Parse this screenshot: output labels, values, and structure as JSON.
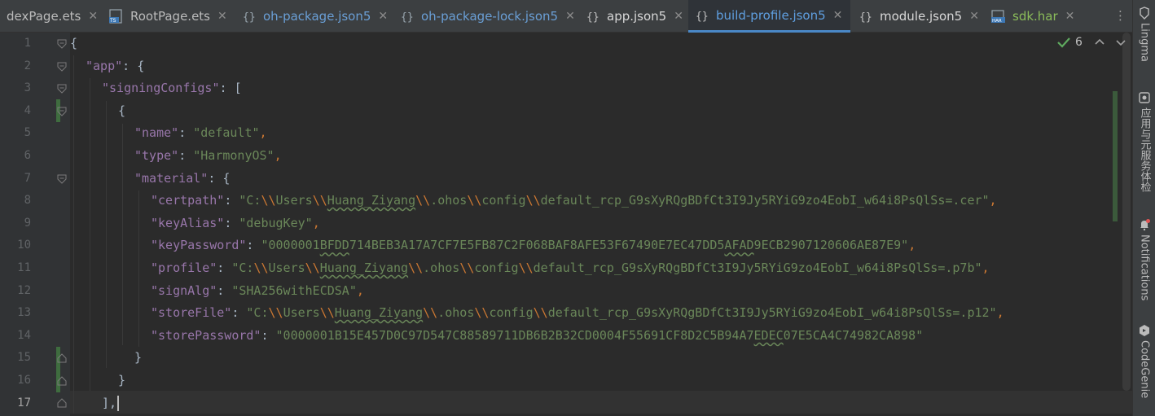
{
  "tabs": [
    {
      "label": "dexPage.ets",
      "icon": "ets-file-icon",
      "type": "ts"
    },
    {
      "label": "RootPage.ets",
      "icon": "ets-file-icon",
      "type": "ts"
    },
    {
      "label": "oh-package.json5",
      "icon": "json5-file-icon",
      "type": "json5"
    },
    {
      "label": "oh-package-lock.json5",
      "icon": "json5-file-icon",
      "type": "json5"
    },
    {
      "label": "app.json5",
      "icon": "json5-file-icon",
      "type": "plain"
    },
    {
      "label": "build-profile.json5",
      "icon": "json5-file-icon",
      "type": "active"
    },
    {
      "label": "module.json5",
      "icon": "json5-file-icon",
      "type": "plain"
    },
    {
      "label": "sdk.har",
      "icon": "har-file-icon",
      "type": "har"
    }
  ],
  "tab_close_glyph": "✕",
  "tabs_more_glyph": "⋮",
  "line_numbers": [
    "1",
    "2",
    "3",
    "4",
    "5",
    "6",
    "7",
    "8",
    "9",
    "10",
    "11",
    "12",
    "13",
    "14",
    "15",
    "16",
    "17"
  ],
  "current_line": "17",
  "inspection": {
    "count": "6"
  },
  "code": {
    "open_brace": "{",
    "app_key": "\"app\"",
    "signing_key": "\"signingConfigs\"",
    "open_bracket": "[",
    "obj_open": "{",
    "name_key": "\"name\"",
    "name_val": "\"default\"",
    "type_key": "\"type\"",
    "type_val": "\"HarmonyOS\"",
    "material_key": "\"material\"",
    "certpath_key": "\"certpath\"",
    "path_prefix": "\"C:",
    "users": "Users",
    "user": "Huang_Ziyang",
    "ohos": ".ohos",
    "config": "config",
    "cert_file": "default_rcp_G9sXyRQgBDfCt3I9Jy5RYiG9zo4EobI_w64i8PsQlSs=.cer\"",
    "keyalias_key": "\"keyAlias\"",
    "keyalias_val": "\"debugKey\"",
    "keypassword_key": "\"keyPassword\"",
    "kp_a": "\"0000001",
    "kp_b": "BFDD",
    "kp_c": "714BEB3A17A7CF7E5FB87C2F068BAF8AFE53F67490E7EC47DD5",
    "kp_d": "AFAD",
    "kp_e": "9ECB2907120606AE87E9\"",
    "profile_key": "\"profile\"",
    "profile_file": "default_rcp_G9sXyRQgBDfCt3I9Jy5RYiG9zo4EobI_w64i8PsQlSs=.p7b\"",
    "signalg_key": "\"signAlg\"",
    "signalg_val": "\"SHA256withECDSA\"",
    "storefile_key": "\"storeFile\"",
    "store_file": "default_rcp_G9sXyRQgBDfCt3I9Jy5RYiG9zo4EobI_w64i8PsQlSs=.p12\"",
    "storepassword_key": "\"storePassword\"",
    "sp_a": "\"0000001B15E457D0C97D547C88589711DB6B2B32CD0004F55691CF8D2C5B94A7",
    "sp_b": "EDEC",
    "sp_c": "07E5CA4C74982CA898\"",
    "close_brace": "}",
    "close_bracket_comma": "],"
  },
  "right_tools": [
    "Lingma",
    "应用与元服务体检",
    "Notifications",
    "CodeGenie"
  ]
}
